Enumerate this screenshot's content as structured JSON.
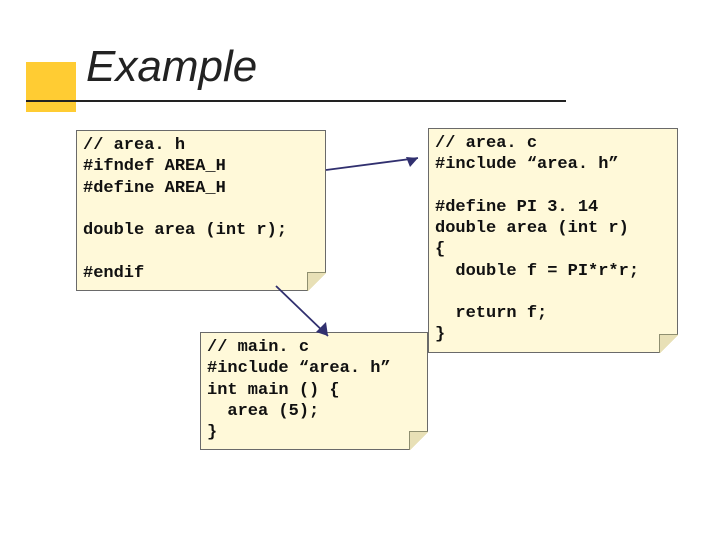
{
  "title": "Example",
  "accent_color": "#ffcc33",
  "code_header": "// area. h\n#ifndef AREA_H\n#define AREA_H\n\ndouble area (int r);\n\n#endif",
  "code_main": "// main. c\n#include “area. h”\nint main () {\n  area (5);\n}",
  "code_impl": "// area. c\n#include “area. h”\n\n#define PI 3. 14\ndouble area (int r)\n{\n  double f = PI*r*r;\n\n  return f;\n}"
}
